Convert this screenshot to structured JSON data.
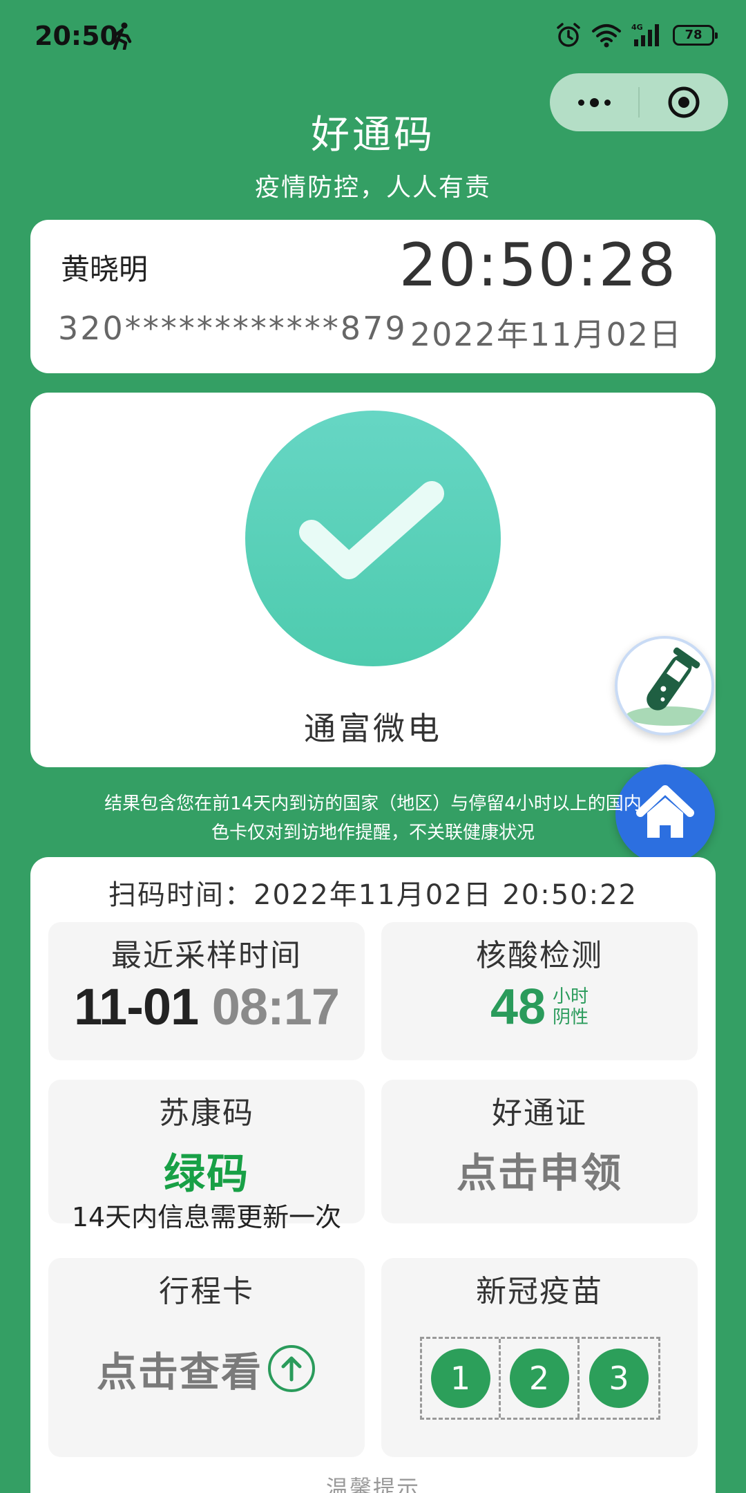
{
  "status_bar": {
    "time": "20:50",
    "battery": "78",
    "network": "4G"
  },
  "header": {
    "title": "好通码",
    "subtitle": "疫情防控，人人有责"
  },
  "identity": {
    "name": "黄晓明",
    "id_number": "320************879",
    "clock": "20:50:28",
    "date": "2022年11月02日"
  },
  "status": {
    "place_name": "通富微电",
    "icon": "check-icon",
    "color": "#4ecbae"
  },
  "notice": {
    "line1": "结果包含您在前14天内到访的国家（地区）与停留4小时以上的国内",
    "line2": "色卡仅对到访地作提醒，不关联健康状况"
  },
  "scan_time": "扫码时间：2022年11月02日 20:50:22",
  "tiles": {
    "sample": {
      "title": "最近采样时间",
      "date": "11-01",
      "time": "08:17"
    },
    "nat": {
      "title": "核酸检测",
      "hours": "48",
      "unit": "小时",
      "result": "阴性",
      "color": "#2a9b5b"
    },
    "sukang": {
      "title": "苏康码",
      "value": "绿码",
      "note": "14天内信息需更新一次",
      "color": "#18a046"
    },
    "pass": {
      "title": "好通证",
      "action": "点击申领"
    },
    "trip": {
      "title": "行程卡",
      "action": "点击查看"
    },
    "vaccine": {
      "title": "新冠疫苗",
      "doses": [
        "1",
        "2",
        "3"
      ]
    }
  },
  "tip_label": "温馨提示",
  "colors": {
    "background": "#349f64",
    "home_button": "#2c6fe0"
  }
}
